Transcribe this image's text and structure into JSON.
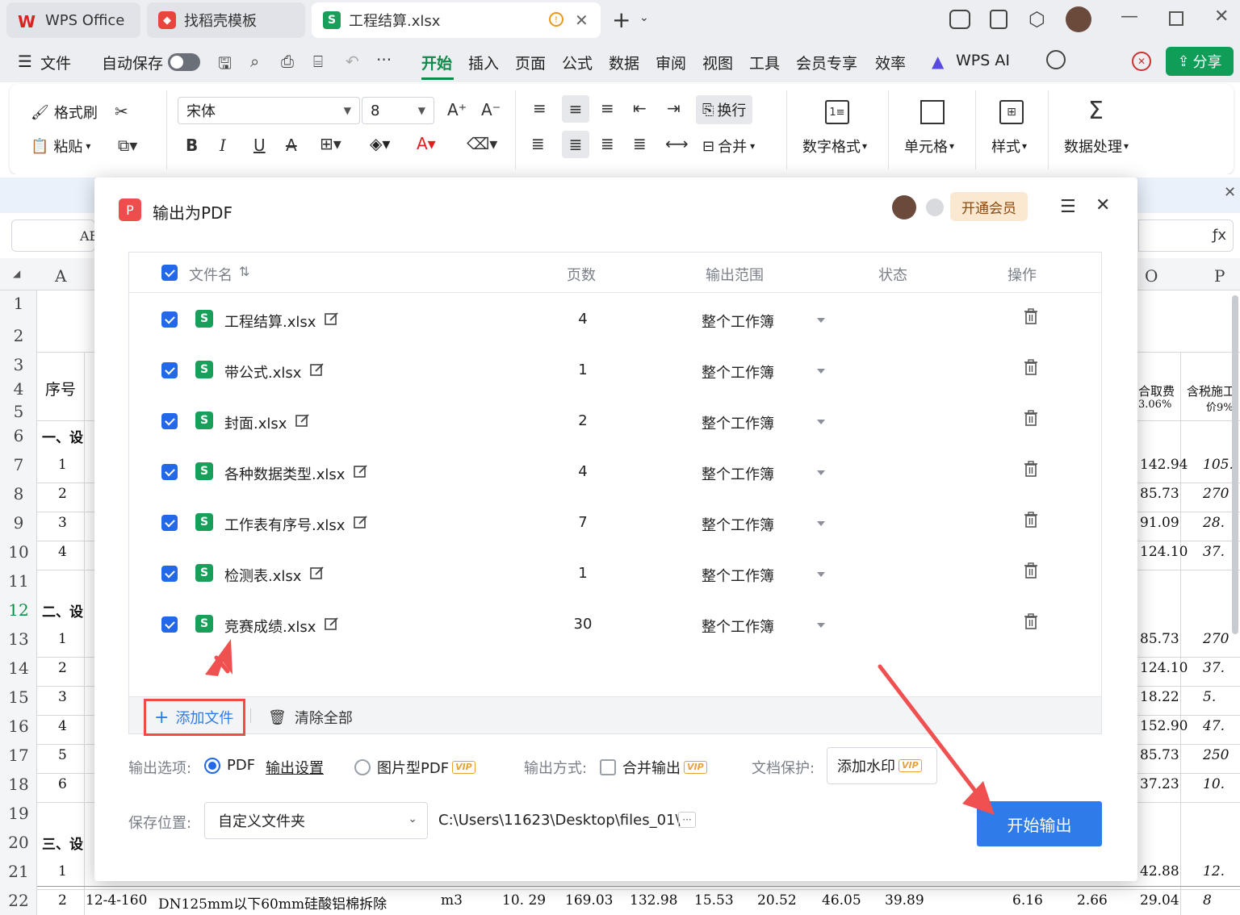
{
  "titlebar": {
    "tabs": [
      {
        "label": "WPS Office"
      },
      {
        "label": "找稻壳模板"
      },
      {
        "label": "工程结算.xlsx"
      }
    ],
    "new_tab": "+"
  },
  "menubar": {
    "file": "文件",
    "autosave": "自动保存",
    "items": [
      "开始",
      "插入",
      "页面",
      "公式",
      "数据",
      "审阅",
      "视图",
      "工具",
      "会员专享",
      "效率"
    ],
    "wps_ai": "WPS AI",
    "share": "分享"
  },
  "ribbon": {
    "format_painter": "格式刷",
    "paste": "粘贴",
    "font_name": "宋体",
    "font_size": "8",
    "wrap": "换行",
    "merge": "合并",
    "number_format": "数字格式",
    "cell": "单元格",
    "style": "样式",
    "data_process": "数据处理"
  },
  "sheet": {
    "col_a": "A",
    "col_o": "O",
    "col_p": "P",
    "name_box": "AE",
    "rows": [
      "1",
      "2",
      "3",
      "4",
      "5",
      "6",
      "7",
      "8",
      "9",
      "10",
      "11",
      "12",
      "13",
      "14",
      "15",
      "16",
      "17",
      "18",
      "19",
      "20",
      "21",
      "22"
    ],
    "header_seq": "序号",
    "sec1": "一、设",
    "sec2": "二、设",
    "sec3": "三、设",
    "a_vals": [
      "1",
      "2",
      "3",
      "4",
      "1",
      "2",
      "3",
      "4",
      "5",
      "6",
      "1",
      "2"
    ],
    "o_header1": "合取费",
    "o_header2": "3.06%",
    "p_header1": "含税施工",
    "p_header2": "价9%",
    "o_vals": [
      "142.94",
      "85.73",
      "91.09",
      "124.10",
      "85.73",
      "124.10",
      "18.22",
      "152.90",
      "85.73",
      "37.23",
      "42.88",
      "29.04"
    ],
    "p_vals": [
      "105.",
      "270",
      "28.",
      "37.",
      "270",
      "37.",
      "5.",
      "47.",
      "250",
      "10.",
      "12.",
      "8"
    ],
    "row22": {
      "code": "12-4-160",
      "desc": "DN125mm以下60mm硅酸铝棉拆除",
      "unit": "m3",
      "v1": "10. 29",
      "v2": "169.03",
      "v3": "132.98",
      "v4": "15.53",
      "v5": "20.52",
      "v6": "46.05",
      "v7": "39.89",
      "v8": "6.16",
      "v9": "2.66"
    }
  },
  "dialog": {
    "title": "输出为PDF",
    "member_btn": "开通会员",
    "columns": {
      "name": "文件名",
      "pages": "页数",
      "range": "输出范围",
      "status": "状态",
      "action": "操作"
    },
    "files": [
      {
        "name": "工程结算.xlsx",
        "pages": "4",
        "range": "整个工作簿"
      },
      {
        "name": "带公式.xlsx",
        "pages": "1",
        "range": "整个工作簿"
      },
      {
        "name": "封面.xlsx",
        "pages": "2",
        "range": "整个工作簿"
      },
      {
        "name": "各种数据类型.xlsx",
        "pages": "4",
        "range": "整个工作簿"
      },
      {
        "name": "工作表有序号.xlsx",
        "pages": "7",
        "range": "整个工作簿"
      },
      {
        "name": "检测表.xlsx",
        "pages": "1",
        "range": "整个工作簿"
      },
      {
        "name": "竞赛成绩.xlsx",
        "pages": "30",
        "range": "整个工作簿"
      }
    ],
    "add_file": "添加文件",
    "clear_all": "清除全部",
    "output_options_label": "输出选项:",
    "pdf": "PDF",
    "output_settings": "输出设置",
    "image_pdf": "图片型PDF",
    "vip": "VIP",
    "output_mode_label": "输出方式:",
    "merge_output": "合并输出",
    "doc_protect_label": "文档保护:",
    "add_watermark": "添加水印",
    "save_location_label": "保存位置:",
    "save_location": "自定义文件夹",
    "save_path": "C:\\Users\\11623\\Desktop\\files_01\\",
    "more": "···",
    "start_button": "开始输出"
  },
  "colors": {
    "accent": "#2f7bea",
    "brand_green": "#0f8a4a",
    "annotation_red": "#f05050"
  }
}
